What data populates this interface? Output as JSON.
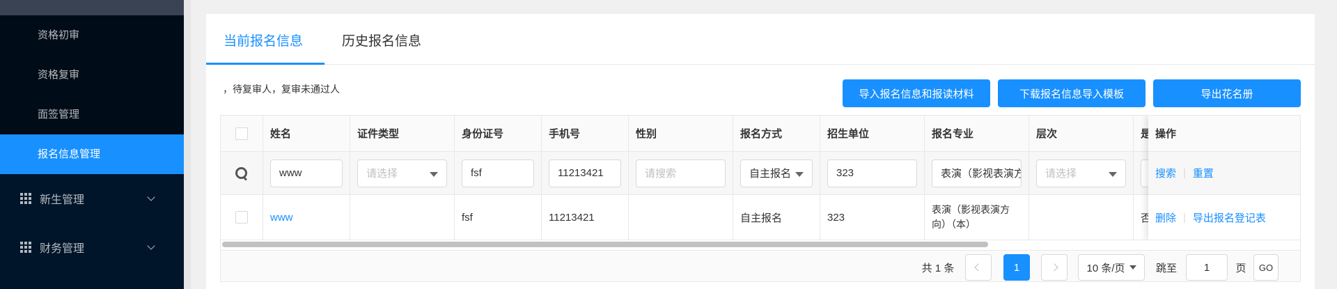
{
  "sidebar": {
    "sub_items": [
      {
        "label": "资格初审"
      },
      {
        "label": "资格复审"
      },
      {
        "label": "面签管理"
      },
      {
        "label": "报名信息管理"
      }
    ],
    "groups": [
      {
        "label": "新生管理"
      },
      {
        "label": "财务管理"
      }
    ]
  },
  "tabs": [
    {
      "label": "当前报名信息"
    },
    {
      "label": "历史报名信息"
    }
  ],
  "hint_text": "，待复审人，复审未通过人",
  "buttons": {
    "import": "导入报名信息和报读材料",
    "download_template": "下载报名信息导入模板",
    "export": "导出花名册"
  },
  "table": {
    "headers": [
      "姓名",
      "证件类型",
      "身份证号",
      "手机号",
      "性别",
      "报名方式",
      "招生单位",
      "报名专业",
      "层次",
      "是"
    ],
    "op_header": "操作",
    "filters": {
      "name": "www",
      "id_type_placeholder": "请选择",
      "id_no": "fsf",
      "phone": "11213421",
      "gender_placeholder": "请搜索",
      "reg_method": "自主报名",
      "unit": "323",
      "major": "表演（影视表演方向）（本）",
      "level_placeholder": "请选择"
    },
    "filter_actions": {
      "search": "搜索",
      "reset": "重置"
    },
    "rows": [
      {
        "name": "www",
        "id_type": "",
        "id_no": "fsf",
        "phone": "11213421",
        "gender": "",
        "reg_method": "自主报名",
        "unit": "323",
        "major_line1": "表演（影视表演方",
        "major_line2": "向）（本）",
        "level": "",
        "extra": "否",
        "actions": {
          "delete": "删除",
          "export_form": "导出报名登记表"
        }
      }
    ]
  },
  "pagination": {
    "total": "共 1 条",
    "current_page": "1",
    "page_size": "10 条/页",
    "jump_label": "跳至",
    "jump_value": "1",
    "page_unit": "页",
    "go_label": "GO"
  },
  "colors": {
    "primary": "#1890ff",
    "sidebar_bg": "#001529",
    "sidebar_sub_bg": "#000c17"
  }
}
